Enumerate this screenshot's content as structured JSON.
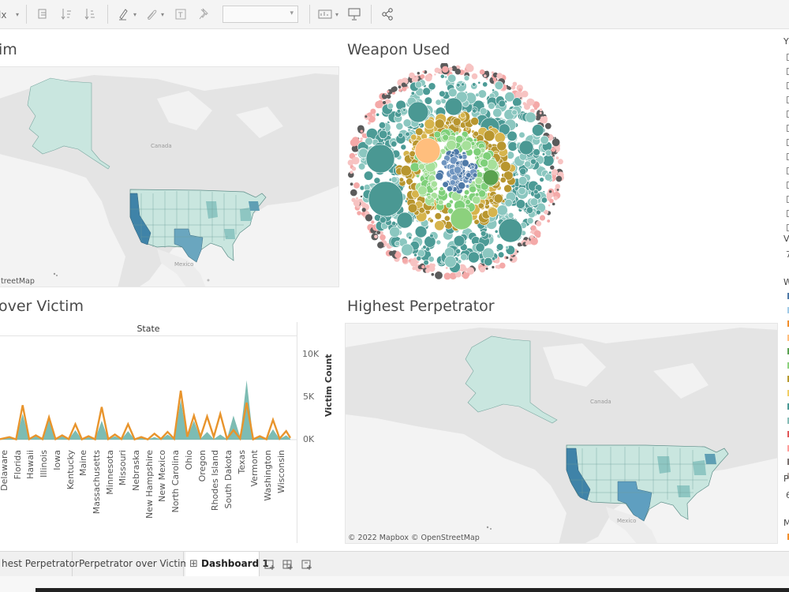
{
  "toolbar": {
    "icons": [
      "clear-sheet-icon",
      "swap-icon",
      "sort-ascending-icon",
      "sort-descending-icon",
      "highlight-icon",
      "group-icon",
      "label-icon",
      "pin-icon",
      "show-me-icon",
      "presentation-icon",
      "share-icon"
    ],
    "fit_value": ""
  },
  "sheets": {
    "top_left_title": "im",
    "weapon_title": "Weapon Used",
    "line_title": "over Victim",
    "highest_title": "Highest Perpetrator"
  },
  "map_top": {
    "attribution": "treetMap",
    "country_canada": "Canada",
    "country_mexico": "Mexico"
  },
  "map_bottom": {
    "attribution": "© 2022 Mapbox © OpenStreetMap",
    "country_canada": "Canada",
    "country_mexico": "Mexico"
  },
  "line_chart_ui": {
    "header": "State",
    "y_title": "Victim Count",
    "y_ticks": [
      "10K",
      "5K",
      "0K"
    ]
  },
  "chart_data": {
    "type": "area",
    "xlabel": "State",
    "ylabel": "Victim Count",
    "ylim": [
      0,
      10000
    ],
    "categories": [
      "Delaware",
      "Florida",
      "Hawaii",
      "Illinois",
      "Iowa",
      "Kentucky",
      "Maine",
      "Massachusetts",
      "Minnesota",
      "Missouri",
      "Nebraska",
      "New Hampshire",
      "New Mexico",
      "North Carolina",
      "Ohio",
      "Oregon",
      "Rhodes Island",
      "South Dakota",
      "Texas",
      "Vermont",
      "Washington",
      "Wisconsin"
    ],
    "series": [
      {
        "values": [
          300,
          4000,
          500,
          2600,
          500,
          1800,
          400,
          3800,
          600,
          1800,
          300,
          700,
          900,
          5700,
          2800,
          2700,
          3000,
          1100,
          4300,
          400,
          2300,
          1000
        ]
      },
      {
        "values": [
          200,
          3000,
          400,
          2900,
          400,
          1100,
          300,
          2200,
          400,
          1000,
          200,
          300,
          600,
          4600,
          2200,
          900,
          600,
          2800,
          6900,
          300,
          1200,
          500
        ]
      }
    ]
  },
  "legend": {
    "letters": [
      "Y",
      "V",
      "W",
      "P",
      "M"
    ],
    "numbers": [
      "7",
      "6"
    ],
    "colors": [
      "#4e79a7",
      "#a0cbe8",
      "#f28e2b",
      "#ffbe7d",
      "#59a14f",
      "#8cd17d",
      "#b6992d",
      "#f1ce63",
      "#499894",
      "#86bcb6",
      "#e15759",
      "#ff9d9a",
      "#79706e",
      "#bab0ac"
    ],
    "bottom_color": "#f28e2b"
  },
  "tabs": {
    "items": [
      "hest Perpetrator",
      "Perpetrator over Victim",
      "Dashboard 1"
    ],
    "active": "Dashboard 1"
  },
  "colors": {
    "map_light": "#c9e6df",
    "map_mid": "#8ec6c2",
    "map_dark": "#3f83a8",
    "line_orange": "#e8942c",
    "area_teal": "#66b0a6"
  }
}
